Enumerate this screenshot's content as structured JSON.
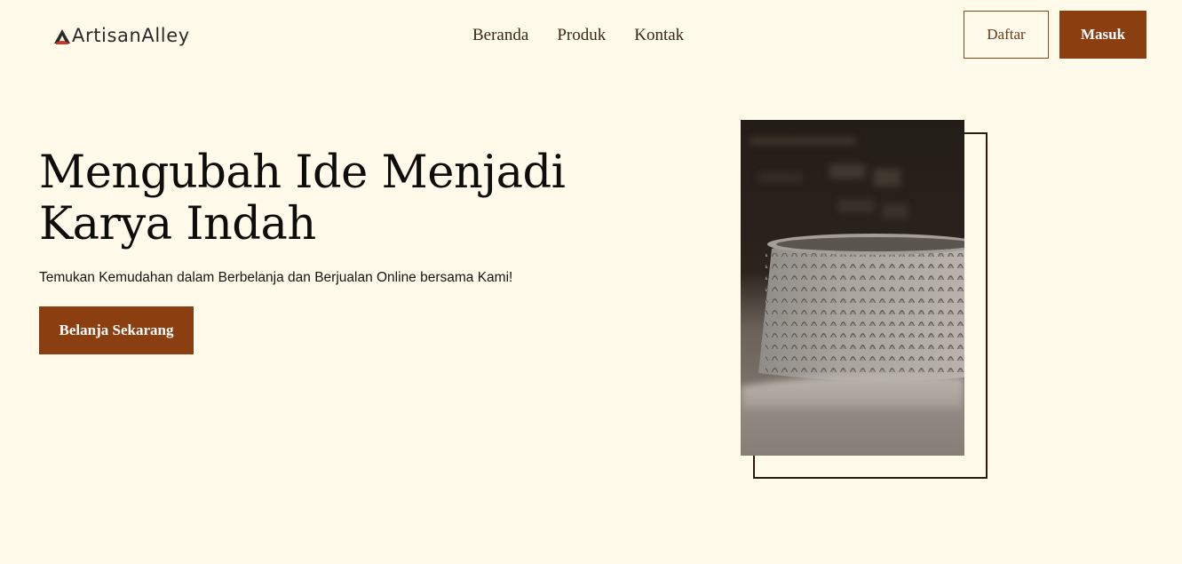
{
  "brand": {
    "name": "ArtisanAlley",
    "logo_icon": "triangle-logo-icon",
    "accent_color": "#c0392b"
  },
  "nav": {
    "items": [
      {
        "label": "Beranda"
      },
      {
        "label": "Produk"
      },
      {
        "label": "Kontak"
      }
    ]
  },
  "auth": {
    "register_label": "Daftar",
    "login_label": "Masuk"
  },
  "hero": {
    "title_line1": "Mengubah Ide Menjadi",
    "title_line2": "Karya Indah",
    "subtitle": "Temukan Kemudahan dalam Berbelanja dan Berjualan Online bersama Kami!",
    "cta_label": "Belanja Sekarang",
    "image_subject": "textured ceramic pottery bowl"
  },
  "theme": {
    "background": "#fffae9",
    "primary": "#8b3f10",
    "text": "#0f0d0b",
    "frame_border": "#2a1a10"
  }
}
